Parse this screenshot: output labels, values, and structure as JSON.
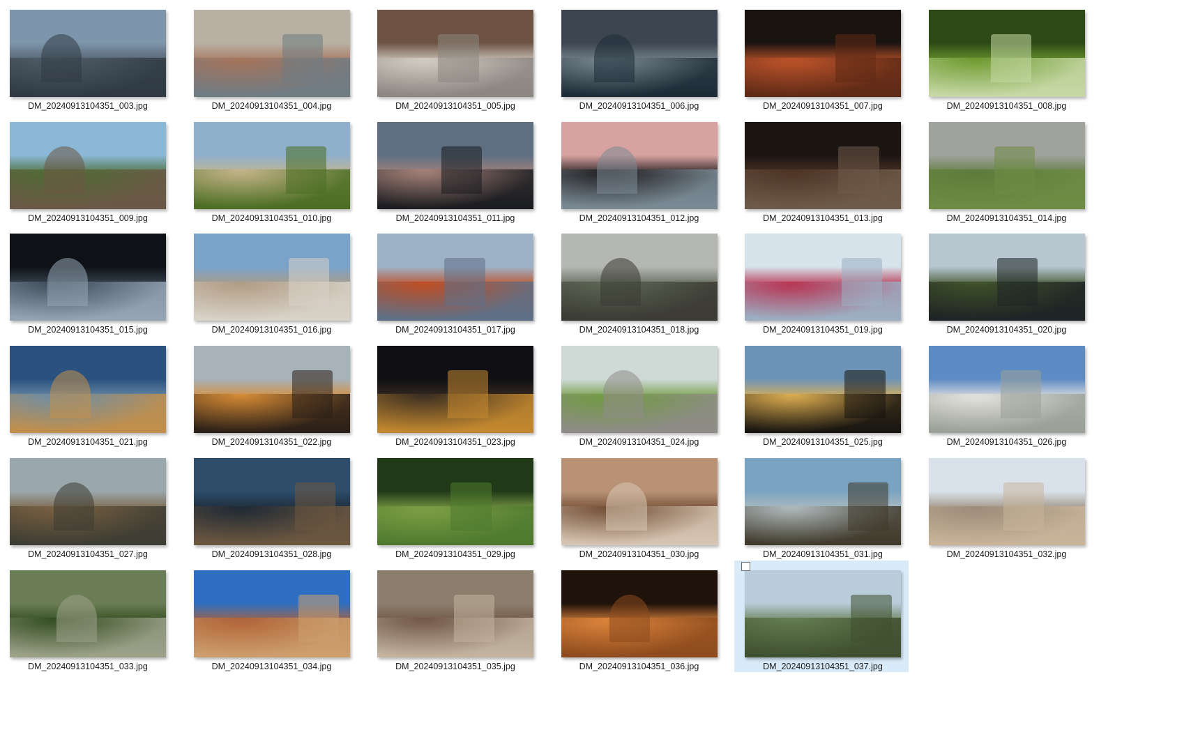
{
  "window": {
    "view": "Large icons"
  },
  "files": [
    {
      "name": "DM_20240913104351_003.jpg",
      "colors": [
        "#7e96ab",
        "#4f5b66",
        "#2f3a44"
      ]
    },
    {
      "name": "DM_20240913104351_004.jpg",
      "colors": [
        "#b8b1a3",
        "#a7735a",
        "#6f7c84"
      ]
    },
    {
      "name": "DM_20240913104351_005.jpg",
      "colors": [
        "#6e5343",
        "#d6d0c7",
        "#8b8680"
      ]
    },
    {
      "name": "DM_20240913104351_006.jpg",
      "colors": [
        "#3d4650",
        "#7b8a93",
        "#1d2b36"
      ]
    },
    {
      "name": "DM_20240913104351_007.jpg",
      "colors": [
        "#1a1410",
        "#c1552b",
        "#5e2a16"
      ]
    },
    {
      "name": "DM_20240913104351_008.jpg",
      "colors": [
        "#2d4a16",
        "#6e9b2f",
        "#c7d8a6"
      ]
    },
    {
      "name": "DM_20240913104351_009.jpg",
      "colors": [
        "#8ab8d6",
        "#4d6b32",
        "#6b5846"
      ]
    },
    {
      "name": "DM_20240913104351_010.jpg",
      "colors": [
        "#8fb0cc",
        "#c7b58a",
        "#4a6d22"
      ]
    },
    {
      "name": "DM_20240913104351_011.jpg",
      "colors": [
        "#5e6f82",
        "#a9847a",
        "#1a1c20"
      ]
    },
    {
      "name": "DM_20240913104351_012.jpg",
      "colors": [
        "#d8a2a0",
        "#1c1a1c",
        "#7b8b96"
      ]
    },
    {
      "name": "DM_20240913104351_013.jpg",
      "colors": [
        "#1c1512",
        "#4c3325",
        "#6f5b4a"
      ]
    },
    {
      "name": "DM_20240913104351_014.jpg",
      "colors": [
        "#a0a39d",
        "#5d7a3a",
        "#6f8c45"
      ]
    },
    {
      "name": "DM_20240913104351_015.jpg",
      "colors": [
        "#0e1217",
        "#3d4a58",
        "#95a5b5"
      ]
    },
    {
      "name": "DM_20240913104351_016.jpg",
      "colors": [
        "#7aa3c9",
        "#b09b82",
        "#d8d2c8"
      ]
    },
    {
      "name": "DM_20240913104351_017.jpg",
      "colors": [
        "#9db2c7",
        "#c14b1f",
        "#5d7088"
      ]
    },
    {
      "name": "DM_20240913104351_018.jpg",
      "colors": [
        "#b5b7b3",
        "#5c6654",
        "#3b3a33"
      ]
    },
    {
      "name": "DM_20240913104351_019.jpg",
      "colors": [
        "#d6e3ea",
        "#b92f4e",
        "#9cb0c4"
      ]
    },
    {
      "name": "DM_20240913104351_020.jpg",
      "colors": [
        "#b7c6cf",
        "#3f5128",
        "#1e2426"
      ]
    },
    {
      "name": "DM_20240913104351_021.jpg",
      "colors": [
        "#2b527f",
        "#6d8ea8",
        "#c28f4a"
      ]
    },
    {
      "name": "DM_20240913104351_022.jpg",
      "colors": [
        "#a8b2b9",
        "#d88c34",
        "#2a1f18"
      ]
    },
    {
      "name": "DM_20240913104351_023.jpg",
      "colors": [
        "#101014",
        "#3a2d22",
        "#c4892f"
      ]
    },
    {
      "name": "DM_20240913104351_024.jpg",
      "colors": [
        "#cfdad7",
        "#6f9a3f",
        "#8f8c88"
      ]
    },
    {
      "name": "DM_20240913104351_025.jpg",
      "colors": [
        "#6d94b6",
        "#e1b050",
        "#171410"
      ]
    },
    {
      "name": "DM_20240913104351_026.jpg",
      "colors": [
        "#5d8bc4",
        "#e7e5e1",
        "#9aa097"
      ]
    },
    {
      "name": "DM_20240913104351_027.jpg",
      "colors": [
        "#9aa7ad",
        "#7a6040",
        "#3d3d33"
      ]
    },
    {
      "name": "DM_20240913104351_028.jpg",
      "colors": [
        "#2d4d6a",
        "#1d2834",
        "#6d5840"
      ]
    },
    {
      "name": "DM_20240913104351_029.jpg",
      "colors": [
        "#203a18",
        "#7fa146",
        "#4f7a2e"
      ]
    },
    {
      "name": "DM_20240913104351_030.jpg",
      "colors": [
        "#b99276",
        "#6f4a31",
        "#d7c6b3"
      ]
    },
    {
      "name": "DM_20240913104351_031.jpg",
      "colors": [
        "#7aa3c1",
        "#b3bdc0",
        "#3f3a2b"
      ]
    },
    {
      "name": "DM_20240913104351_032.jpg",
      "colors": [
        "#d9e2ea",
        "#9a8a77",
        "#c9b49a"
      ]
    },
    {
      "name": "DM_20240913104351_033.jpg",
      "colors": [
        "#6b7d54",
        "#2f4a1d",
        "#9da28a"
      ]
    },
    {
      "name": "DM_20240913104351_034.jpg",
      "colors": [
        "#2f6fc2",
        "#b16235",
        "#cc9f6d"
      ]
    },
    {
      "name": "DM_20240913104351_035.jpg",
      "colors": [
        "#8c7e6d",
        "#6f5444",
        "#c2b49f"
      ]
    },
    {
      "name": "DM_20240913104351_036.jpg",
      "colors": [
        "#1e120b",
        "#e1873d",
        "#8d4b1d"
      ]
    },
    {
      "name": "DM_20240913104351_037.jpg",
      "colors": [
        "#b8ccd9",
        "#647b4f",
        "#3f5030"
      ],
      "selected": true
    }
  ],
  "selection_color": "#d9ebf9"
}
